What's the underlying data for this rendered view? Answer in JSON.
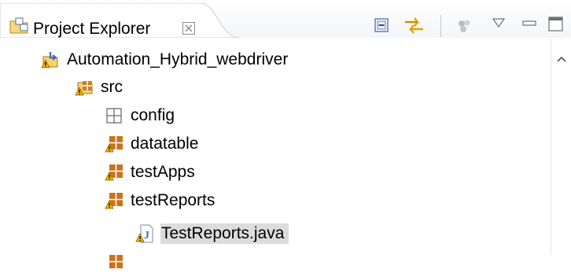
{
  "view": {
    "tab_title": "Project Explorer",
    "close_glyph": "⊠"
  },
  "toolbar": {
    "items": [
      {
        "name": "collapse-all-icon"
      },
      {
        "name": "link-with-editor-icon"
      },
      {
        "name": "filters-icon"
      },
      {
        "name": "view-menu-icon"
      },
      {
        "name": "minimize-icon"
      },
      {
        "name": "maximize-icon"
      }
    ]
  },
  "tree": {
    "items": [
      {
        "label": "Automation_Hybrid_webdriver",
        "type": "project",
        "icon": "java-project-warning-icon"
      },
      {
        "label": "src",
        "type": "source-folder",
        "icon": "source-folder-warning-icon"
      },
      {
        "label": "config",
        "type": "empty-package",
        "icon": "empty-package-icon"
      },
      {
        "label": "datatable",
        "type": "package",
        "icon": "package-warning-icon"
      },
      {
        "label": "testApps",
        "type": "package",
        "icon": "package-warning-icon"
      },
      {
        "label": "testReports",
        "type": "package",
        "icon": "package-warning-icon"
      },
      {
        "label": "TestReports.java",
        "type": "java-file",
        "icon": "java-file-warning-icon",
        "selected": true
      }
    ]
  },
  "colors": {
    "package": "#c8741c",
    "warning": "#f2b400",
    "java_blue": "#3c6fb8",
    "selection": "#dcdcdc",
    "toolbar_icon": "#5d7fb5"
  }
}
